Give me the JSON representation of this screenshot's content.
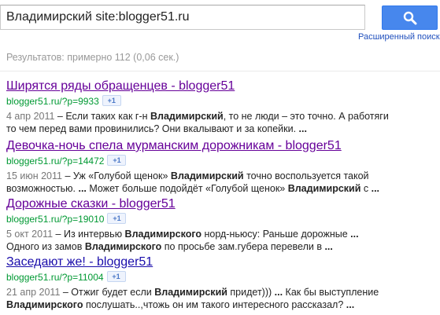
{
  "search": {
    "query": "Владимирский site:blogger51.ru",
    "advanced_search": "Расширенный поиск"
  },
  "stats": "Результатов: примерно 112 (0,06 сек.)",
  "plus_one_label": "+1",
  "results": [
    {
      "title": "Ширятся ряды обращенцев - blogger51",
      "url": "blogger51.ru/?p=9933",
      "date": "4 апр 2011",
      "line1": [
        " – Если таких как г-н ",
        "Владимирский",
        ", то не люди – это точно. А работяги"
      ],
      "line2": [
        "то чем перед вами провинились? Они вкалывают и за копейки. ",
        "..."
      ]
    },
    {
      "title": "Девочка-ночь спела мурманским дорожникам - blogger51",
      "url": "blogger51.ru/?p=14472",
      "date": "15 июн 2011",
      "line1": [
        " – Уж «Голубой щенок» ",
        "Владимирский",
        " точно воспользуется такой"
      ],
      "line2": [
        "возможностью. ",
        "...",
        " Может больше подойдёт «Голубой щенок» ",
        "Владимирский",
        " с ",
        "..."
      ]
    },
    {
      "title": "Дорожные сказки - blogger51",
      "url": "blogger51.ru/?p=19010",
      "date": "5 окт 2011",
      "line1": [
        " – Из интервью ",
        "Владимирского",
        " норд-ньюсу: Раньше дорожные ",
        "..."
      ],
      "line2": [
        "Одного из замов ",
        "Владимирского",
        " по просьбе зам.губера перевели в ",
        "..."
      ]
    },
    {
      "title": "Заседают же! - blogger51",
      "url": "blogger51.ru/?p=11004",
      "date": "21 апр 2011",
      "line1": [
        " – Отжиг будет если ",
        "Владимирский",
        " придет))) ",
        "...",
        " Как бы выступление"
      ],
      "line2": [
        "Владимирского",
        " послушать..,чтожь он им такого интересного рассказал? ",
        "..."
      ]
    }
  ]
}
